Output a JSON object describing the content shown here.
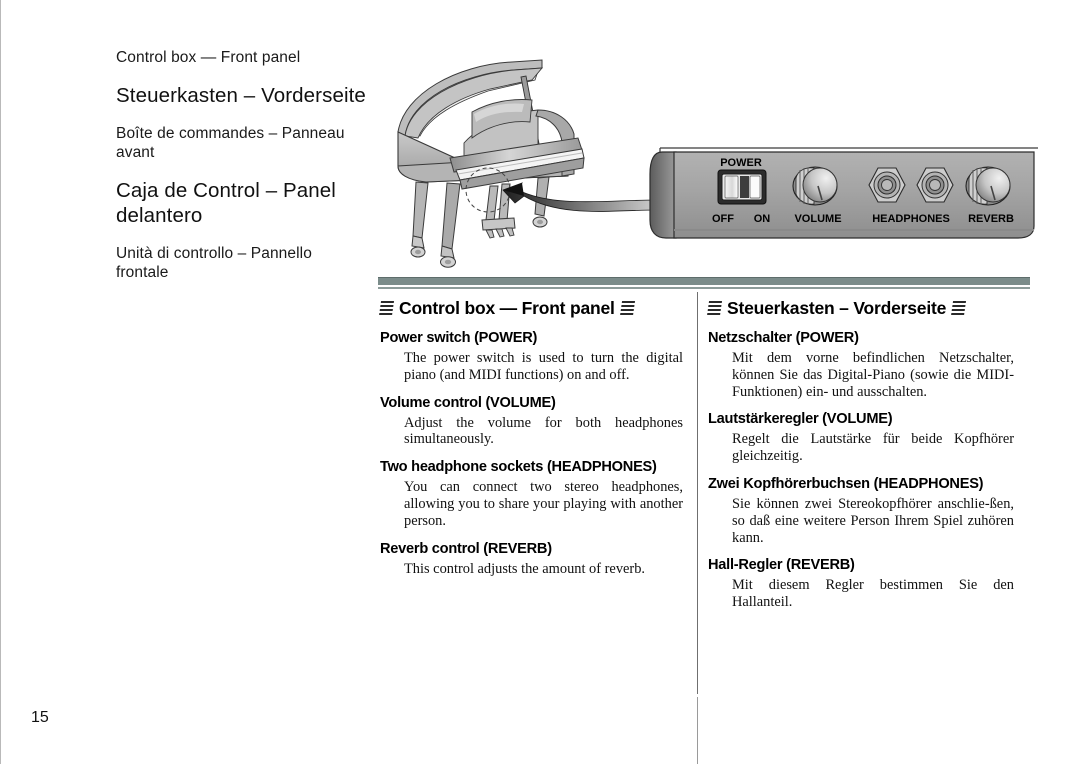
{
  "page": {
    "number": "15",
    "rule_color": "#7b8c8a",
    "divider_color": "#6f6f6f"
  },
  "lang_headings": [
    {
      "text": "Control box — Front panel",
      "size": "small",
      "lang": "en"
    },
    {
      "text": "Steuerkasten – Vorderseite",
      "size": "big",
      "lang": "de"
    },
    {
      "text": "Boîte de commandes – Panneau avant",
      "size": "small",
      "lang": "fr"
    },
    {
      "text": "Caja de Control – Panel delantero",
      "size": "big",
      "lang": "es"
    },
    {
      "text": "Unità di controllo – Pannello frontale",
      "size": "small",
      "lang": "it"
    }
  ],
  "illustration": {
    "piano_label": "grand-piano-illustration",
    "arrow_label": "callout-arrow",
    "control_box": {
      "power_label": "POWER",
      "off_label": "OFF",
      "on_label": "ON",
      "volume_label": "VOLUME",
      "headphones_label": "HEADPHONES",
      "reverb_label": "REVERB",
      "panel_color": "#a3a3a3"
    }
  },
  "columns": {
    "english": {
      "heading": "Control box — Front panel",
      "items": [
        {
          "title": "Power switch (POWER)",
          "body": "The power switch is used to turn the digital piano (and MIDI functions) on and off."
        },
        {
          "title": "Volume control (VOLUME)",
          "body": "Adjust the volume for both headphones simultaneously."
        },
        {
          "title": "Two headphone sockets (HEADPHONES)",
          "body": "You can connect two stereo headphones, allowing you to share your playing with another person."
        },
        {
          "title": "Reverb control (REVERB)",
          "body": "This control adjusts the amount of reverb."
        }
      ]
    },
    "german": {
      "heading": "Steuerkasten – Vorderseite",
      "items": [
        {
          "title": "Netzschalter (POWER)",
          "body": "Mit dem vorne befindlichen Netzschalter, können Sie das Digital-Piano (sowie die MIDI-Funktionen) ein- und ausschalten."
        },
        {
          "title": "Lautstärkeregler (VOLUME)",
          "body": "Regelt die Lautstärke für beide Kopfhörer gleichzeitig."
        },
        {
          "title": "Zwei Kopfhörerbuchsen (HEADPHONES)",
          "body": "Sie können zwei Stereokopfhörer anschlie-ßen, so daß eine weitere Person Ihrem Spiel zuhören kann."
        },
        {
          "title": "Hall-Regler (REVERB)",
          "body": "Mit diesem Regler bestimmen Sie den Hallanteil."
        }
      ]
    }
  }
}
